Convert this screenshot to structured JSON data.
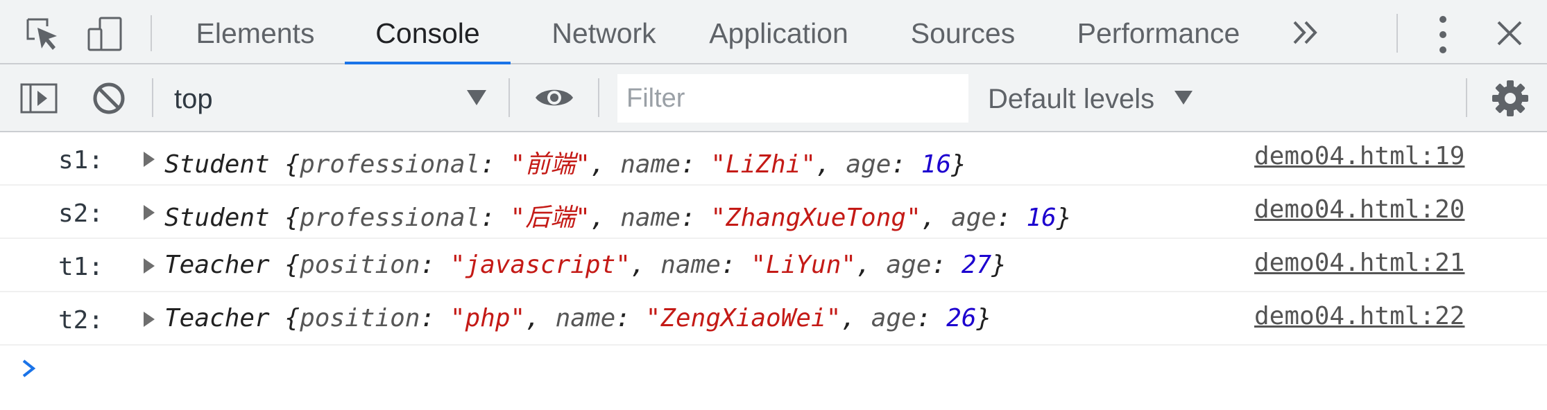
{
  "devtools": {
    "tabs": [
      {
        "label": "Elements",
        "active": false
      },
      {
        "label": "Console",
        "active": true
      },
      {
        "label": "Network",
        "active": false
      },
      {
        "label": "Application",
        "active": false
      },
      {
        "label": "Sources",
        "active": false
      },
      {
        "label": "Performance",
        "active": false
      }
    ],
    "icons": [
      "inspect-element-icon",
      "device-toolbar-icon",
      "more-tabs-icon",
      "kebab-menu-icon",
      "close-icon"
    ]
  },
  "console_toolbar": {
    "context": "top",
    "filter_placeholder": "Filter",
    "filter_value": "",
    "levels": "Default levels",
    "icons": [
      "sidebar-toggle-icon",
      "clear-console-icon",
      "context-dropdown-icon",
      "live-expression-eye-icon",
      "levels-dropdown-icon",
      "settings-gear-icon"
    ]
  },
  "messages": [
    {
      "label": "s1:",
      "class_name": "Student",
      "props": [
        {
          "key": "professional",
          "value": "\"前端\"",
          "type": "string"
        },
        {
          "key": "name",
          "value": "\"LiZhi\"",
          "type": "string"
        },
        {
          "key": "age",
          "value": "16",
          "type": "number"
        }
      ],
      "source": "demo04.html:19"
    },
    {
      "label": "s2:",
      "class_name": "Student",
      "props": [
        {
          "key": "professional",
          "value": "\"后端\"",
          "type": "string"
        },
        {
          "key": "name",
          "value": "\"ZhangXueTong\"",
          "type": "string"
        },
        {
          "key": "age",
          "value": "16",
          "type": "number"
        }
      ],
      "source": "demo04.html:20"
    },
    {
      "label": "t1:",
      "class_name": "Teacher",
      "props": [
        {
          "key": "position",
          "value": "\"javascript\"",
          "type": "string"
        },
        {
          "key": "name",
          "value": "\"LiYun\"",
          "type": "string"
        },
        {
          "key": "age",
          "value": "27",
          "type": "number"
        }
      ],
      "source": "demo04.html:21"
    },
    {
      "label": "t2:",
      "class_name": "Teacher",
      "props": [
        {
          "key": "position",
          "value": "\"php\"",
          "type": "string"
        },
        {
          "key": "name",
          "value": "\"ZengXiaoWei\"",
          "type": "string"
        },
        {
          "key": "age",
          "value": "26",
          "type": "number"
        }
      ],
      "source": "demo04.html:22"
    }
  ],
  "colors": {
    "accent": "#1a73e8",
    "string": "#c41a16",
    "number": "#1c00cf",
    "key": "#565656"
  }
}
